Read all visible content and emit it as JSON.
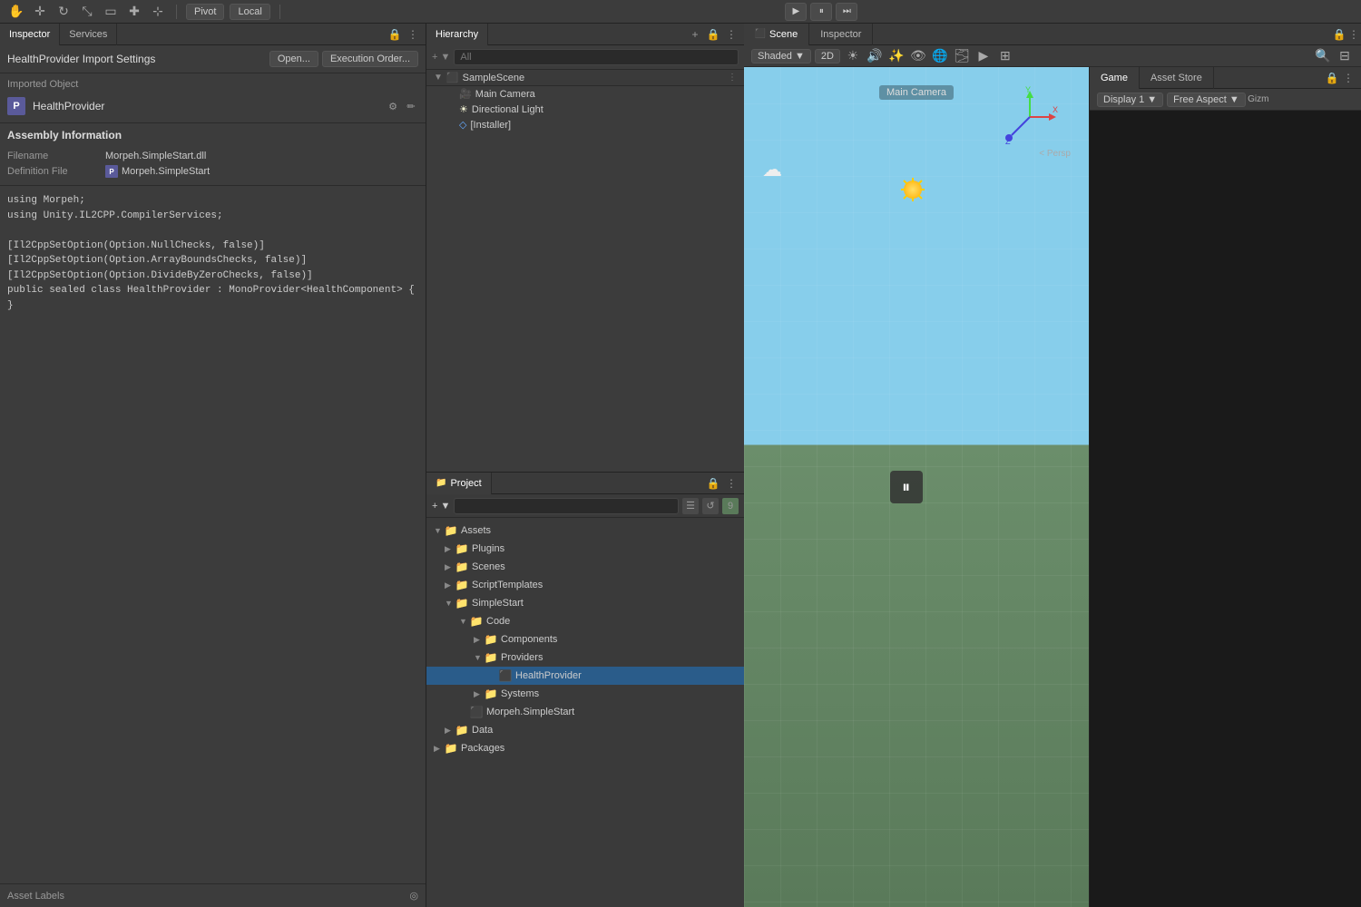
{
  "toolbar": {
    "pivot_label": "Pivot",
    "local_label": "Local",
    "play_icon": "▶",
    "pause_icon": "⏸",
    "step_icon": "⏭"
  },
  "left_panel": {
    "tabs": [
      {
        "label": "Inspector",
        "active": true
      },
      {
        "label": "Services",
        "active": false
      }
    ],
    "title": "HealthProvider Import Settings",
    "open_btn": "Open...",
    "execution_btn": "Execution Order...",
    "imported_object": {
      "label": "Imported Object",
      "name": "HealthProvider",
      "icon": "P"
    },
    "assembly": {
      "title": "Assembly Information",
      "filename_label": "Filename",
      "filename_value": "Morpeh.SimpleStart.dll",
      "def_file_label": "Definition File",
      "def_file_value": "Morpeh.SimpleStart",
      "def_file_icon": "P"
    },
    "code": {
      "lines": [
        "using Morpeh;",
        "using Unity.IL2CPP.CompilerServices;",
        "",
        "[Il2CppSetOption(Option.NullChecks, false)]",
        "[Il2CppSetOption(Option.ArrayBoundsChecks, false)]",
        "[Il2CppSetOption(Option.DivideByZeroChecks, false)]",
        "public sealed class HealthProvider : MonoProvider<HealthComponent> {",
        "}"
      ]
    },
    "asset_labels": "Asset Labels"
  },
  "hierarchy": {
    "tab_label": "Hierarchy",
    "search_placeholder": "All",
    "scene": {
      "name": "SampleScene",
      "children": [
        {
          "name": "Main Camera",
          "indent": 1,
          "icon": "camera"
        },
        {
          "name": "Directional Light",
          "indent": 1,
          "icon": "light"
        },
        {
          "name": "[Installer]",
          "indent": 1,
          "icon": "obj"
        }
      ]
    }
  },
  "project": {
    "tab_label": "Project",
    "search_placeholder": "",
    "tree": {
      "assets": {
        "label": "Assets",
        "expanded": true,
        "children": [
          {
            "label": "Plugins",
            "indent": 1,
            "expanded": false
          },
          {
            "label": "Scenes",
            "indent": 1,
            "expanded": false
          },
          {
            "label": "ScriptTemplates",
            "indent": 1,
            "expanded": false
          },
          {
            "label": "SimpleStart",
            "indent": 1,
            "expanded": true,
            "children": [
              {
                "label": "Code",
                "indent": 2,
                "expanded": true,
                "children": [
                  {
                    "label": "Components",
                    "indent": 3,
                    "expanded": false
                  },
                  {
                    "label": "Providers",
                    "indent": 3,
                    "expanded": true,
                    "children": [
                      {
                        "label": "HealthProvider",
                        "indent": 4,
                        "selected": true,
                        "isScript": true
                      }
                    ]
                  },
                  {
                    "label": "Systems",
                    "indent": 3,
                    "expanded": false
                  }
                ]
              },
              {
                "label": "Morpeh.SimpleStart",
                "indent": 2,
                "isScript": true
              }
            ]
          },
          {
            "label": "Data",
            "indent": 1,
            "expanded": false
          }
        ]
      },
      "packages": {
        "label": "Packages",
        "expanded": false
      }
    }
  },
  "scene": {
    "tabs": [
      {
        "label": "Scene",
        "icon": "⬛",
        "active": true
      },
      {
        "label": "Inspector",
        "active": false
      }
    ],
    "toolbar": {
      "shaded": "Shaded",
      "mode_2d": "2D"
    },
    "persp_label": "< Persp"
  },
  "game": {
    "tab_label": "Game",
    "asset_store_label": "Asset Store",
    "display": "Display 1",
    "aspect": "Free Aspect",
    "gizm_label": "Gizm"
  },
  "main_camera_label": "Main Camera",
  "icons": {
    "lock": "🔒",
    "menu": "⋮",
    "gear": "⚙",
    "eye": "👁",
    "add": "+",
    "search": "🔍",
    "folder": "📁",
    "script": "📄",
    "arrow_right": "▶",
    "arrow_down": "▼"
  }
}
